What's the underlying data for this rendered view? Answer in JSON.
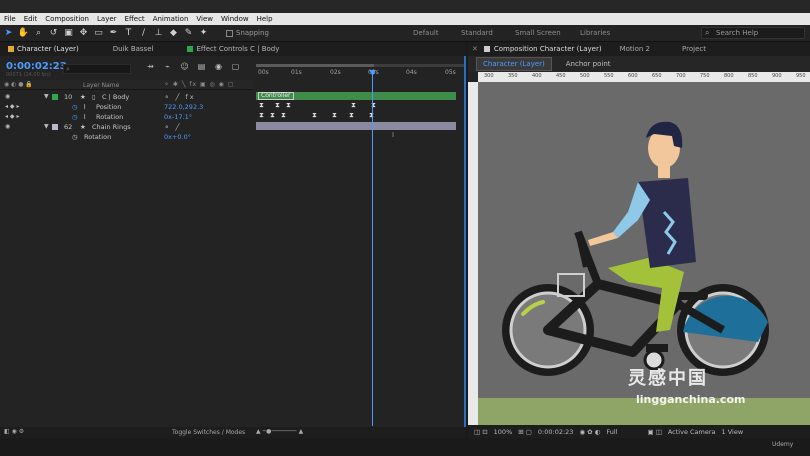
{
  "menu": [
    "File",
    "Edit",
    "Composition",
    "Layer",
    "Effect",
    "Animation",
    "View",
    "Window",
    "Help"
  ],
  "toolbar": {
    "snapping_label": "Snapping",
    "workspaces": [
      "Default",
      "Standard",
      "Small Screen",
      "Libraries"
    ],
    "search_placeholder": "Search Help"
  },
  "timeline_panel": {
    "tabs": [
      {
        "label": "Character (Layer)",
        "color": "#e0a93a"
      },
      {
        "label": "Duik Bassel",
        "color": ""
      },
      {
        "label": "Effect Controls C | Body",
        "color": "#2fa84a"
      }
    ],
    "timecode": "0:00:02:23",
    "timecode_sub": "00071 (24.00 fps)",
    "search_placeholder": "",
    "column_header": "Layer Name",
    "ruler_labels": [
      "00s",
      "01s",
      "02s",
      "03s",
      "04s",
      "05s"
    ],
    "layers": [
      {
        "num": "10",
        "name": "C | Body",
        "color": "#2fa84a",
        "value": ""
      },
      {
        "num": "",
        "name": "Position",
        "color": "",
        "value": "722.0,292.3"
      },
      {
        "num": "",
        "name": "Rotation",
        "color": "",
        "value": "0x-17.1°"
      },
      {
        "num": "62",
        "name": "Chain Rings",
        "color": "#b9b9d3",
        "value": ""
      },
      {
        "num": "",
        "name": "Rotation",
        "color": "",
        "value": "0x+0.0°"
      }
    ],
    "track_label": "Controller",
    "footer_label": "Toggle Switches / Modes"
  },
  "composition_panel": {
    "tabs": [
      "Composition Character (Layer)",
      "Motion 2",
      "Project"
    ],
    "sub_tabs": [
      "Character (Layer)",
      "Anchor point"
    ],
    "ruler_numbers": [
      "300",
      "350",
      "400",
      "450",
      "500",
      "550",
      "600",
      "650",
      "700",
      "750",
      "800",
      "850",
      "900",
      "950"
    ],
    "zoom": "100%",
    "timecode": "0:00:02:23",
    "resolution": "Full",
    "camera": "Active Camera",
    "views": "1 View"
  },
  "watermark": {
    "cn_text": "灵感中国",
    "url_text": "lingganchina.com"
  },
  "footer_brand": "Udemy",
  "colors": {
    "accent": "#4e9bff",
    "track_green": "#3f8c4a",
    "track_lavender": "#8a8aa0",
    "panel_bg": "#232323",
    "ground": "#8ea567"
  }
}
